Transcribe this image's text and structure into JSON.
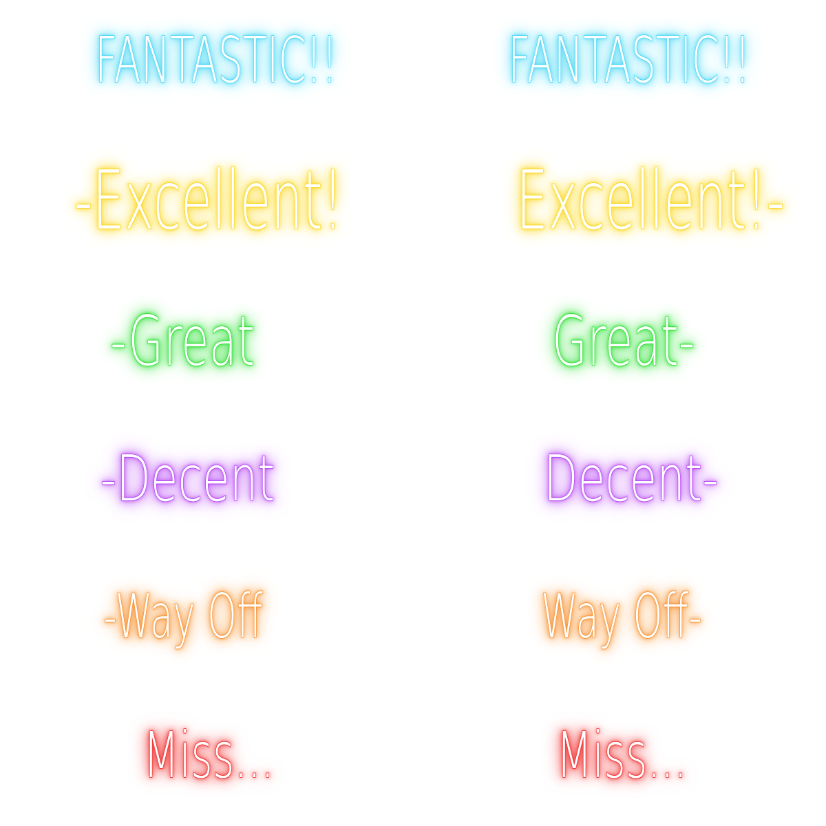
{
  "colors": {
    "fantastic": "#3fd3f2",
    "excellent": "#f9d51a",
    "great": "#22dd2a",
    "decent": "#b13cf0",
    "way_off": "#f58a24",
    "miss": "#ee2424"
  },
  "left_column": {
    "fantastic": "FANTASTIC!!",
    "excellent": "-Excellent!",
    "great": "-Great",
    "decent": "-Decent",
    "way_off": "-Way Off",
    "miss": "Miss..."
  },
  "right_column": {
    "fantastic": "FANTASTIC!!",
    "excellent": "Excellent!-",
    "great": "Great-",
    "decent": "Decent-",
    "way_off": "Way Off-",
    "miss": "Miss..."
  }
}
